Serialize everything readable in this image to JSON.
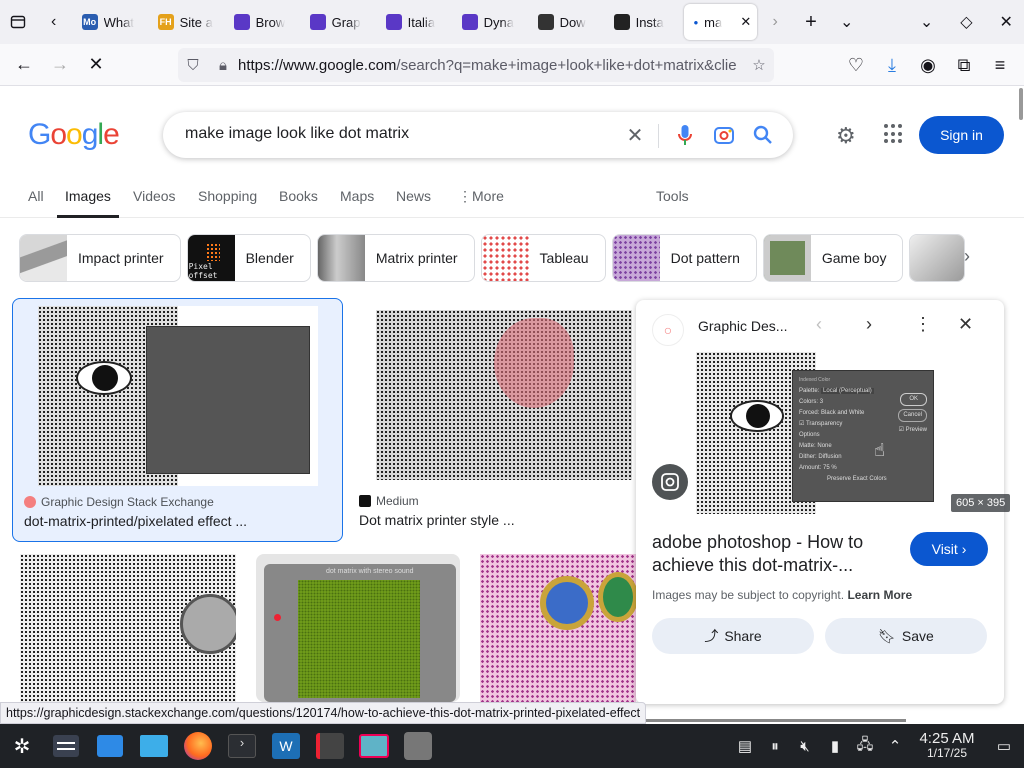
{
  "browser": {
    "tabs": [
      {
        "title": "What",
        "fav": "Mo",
        "color": "#2a5db0"
      },
      {
        "title": "Site a",
        "fav": "FH",
        "color": "#e4a11b"
      },
      {
        "title": "Brow",
        "fav": "",
        "color": "#5a38c6"
      },
      {
        "title": "Grap",
        "fav": "",
        "color": "#5a38c6"
      },
      {
        "title": "Italia",
        "fav": "",
        "color": "#5a38c6"
      },
      {
        "title": "Dyna",
        "fav": "",
        "color": "#5a38c6"
      },
      {
        "title": "Dow",
        "fav": "",
        "color": "#333"
      },
      {
        "title": "Insta",
        "fav": "",
        "color": "#222"
      }
    ],
    "active_tab": "ma",
    "url_host": "https://www.google.com",
    "url_rest": "/search?q=make+image+look+like+dot+matrix&clie"
  },
  "google": {
    "logo": "Google",
    "query": "make image look like dot matrix",
    "signin": "Sign in",
    "tabs": [
      "All",
      "Images",
      "Videos",
      "Shopping",
      "Books",
      "Maps",
      "News",
      "More"
    ],
    "active_tab": "Images",
    "tools": "Tools",
    "chips": [
      "Impact printer",
      "Blender",
      "Matrix printer",
      "Tableau",
      "Dot pattern",
      "Game boy"
    ],
    "chip_blender_caption": "Pixel offset"
  },
  "results": [
    {
      "source": "Graphic Design Stack Exchange",
      "title": "dot-matrix-printed/pixelated effect ..."
    },
    {
      "source": "Medium",
      "title": "Dot matrix printer style ..."
    }
  ],
  "dialog": {
    "title": "Indexed Color",
    "palette_label": "Palette:",
    "palette_value": "Local (Perceptual)",
    "colors_label": "Colors:",
    "colors_value": "3",
    "forced_label": "Forced:",
    "forced_value": "Black and White",
    "transparency": "Transparency",
    "options": "Options",
    "matte_label": "Matte:",
    "matte_value": "None",
    "dither_label": "Dither:",
    "dither_value": "Diffusion",
    "amount_label": "Amount:",
    "amount_value": "75",
    "pct": "%",
    "preserve": "Preserve Exact Colors",
    "ok": "OK",
    "cancel": "Cancel",
    "preview": "Preview"
  },
  "gameboy_caption": "dot matrix with stereo sound",
  "panel": {
    "source": "Graphic Des...",
    "dimensions": "605 × 395",
    "title": "adobe photoshop - How to achieve this dot-matrix-...",
    "visit": "Visit",
    "copyright": "Images may be subject to copyright.",
    "learn_more": "Learn More",
    "share": "Share",
    "save": "Save"
  },
  "status_url": "https://graphicdesign.stackexchange.com/questions/120174/how-to-achieve-this-dot-matrix-printed-pixelated-effect",
  "taskbar": {
    "time": "4:25 AM",
    "date": "1/17/25"
  }
}
